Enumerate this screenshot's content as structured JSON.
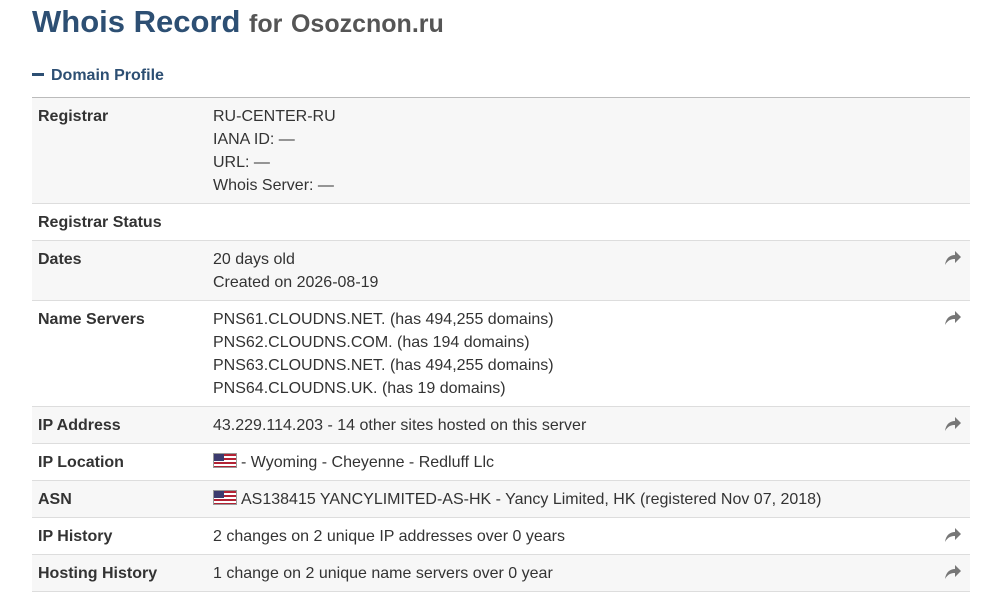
{
  "header": {
    "title": "Whois Record",
    "for_text": "for",
    "domain": "Osozcnon.ru"
  },
  "section": {
    "title": "Domain Profile"
  },
  "rows": {
    "registrar": {
      "label": "Registrar",
      "lines": [
        "RU-CENTER-RU",
        "IANA ID: —",
        "URL: —",
        "Whois Server: —"
      ]
    },
    "registrar_status": {
      "label": "Registrar Status",
      "lines": [
        ""
      ]
    },
    "dates": {
      "label": "Dates",
      "lines": [
        "20 days old",
        "Created on 2026-08-19"
      ]
    },
    "name_servers": {
      "label": "Name Servers",
      "lines": [
        "PNS61.CLOUDNS.NET. (has 494,255 domains)",
        "PNS62.CLOUDNS.COM. (has 194 domains)",
        "PNS63.CLOUDNS.NET. (has 494,255 domains)",
        "PNS64.CLOUDNS.UK. (has 19 domains)"
      ]
    },
    "ip_address": {
      "label": "IP Address",
      "lines": [
        "43.229.114.203 - 14 other sites hosted on this server"
      ]
    },
    "ip_location": {
      "label": "IP Location",
      "lines": [
        "- Wyoming - Cheyenne - Redluff Llc"
      ]
    },
    "asn": {
      "label": "ASN",
      "lines": [
        "AS138415 YANCYLIMITED-AS-HK - Yancy Limited, HK (registered Nov 07, 2018)"
      ]
    },
    "ip_history": {
      "label": "IP History",
      "lines": [
        "2 changes on 2 unique IP addresses over 0 years"
      ]
    },
    "hosting_history": {
      "label": "Hosting History",
      "lines": [
        "1 change on 2 unique name servers over 0 year"
      ]
    }
  },
  "icons": {
    "share": "share-arrow-icon",
    "flag": "us-flag-icon",
    "collapse": "minus-icon"
  },
  "colors": {
    "title": "#2d4f73",
    "text": "#333333",
    "icon": "#777777"
  }
}
